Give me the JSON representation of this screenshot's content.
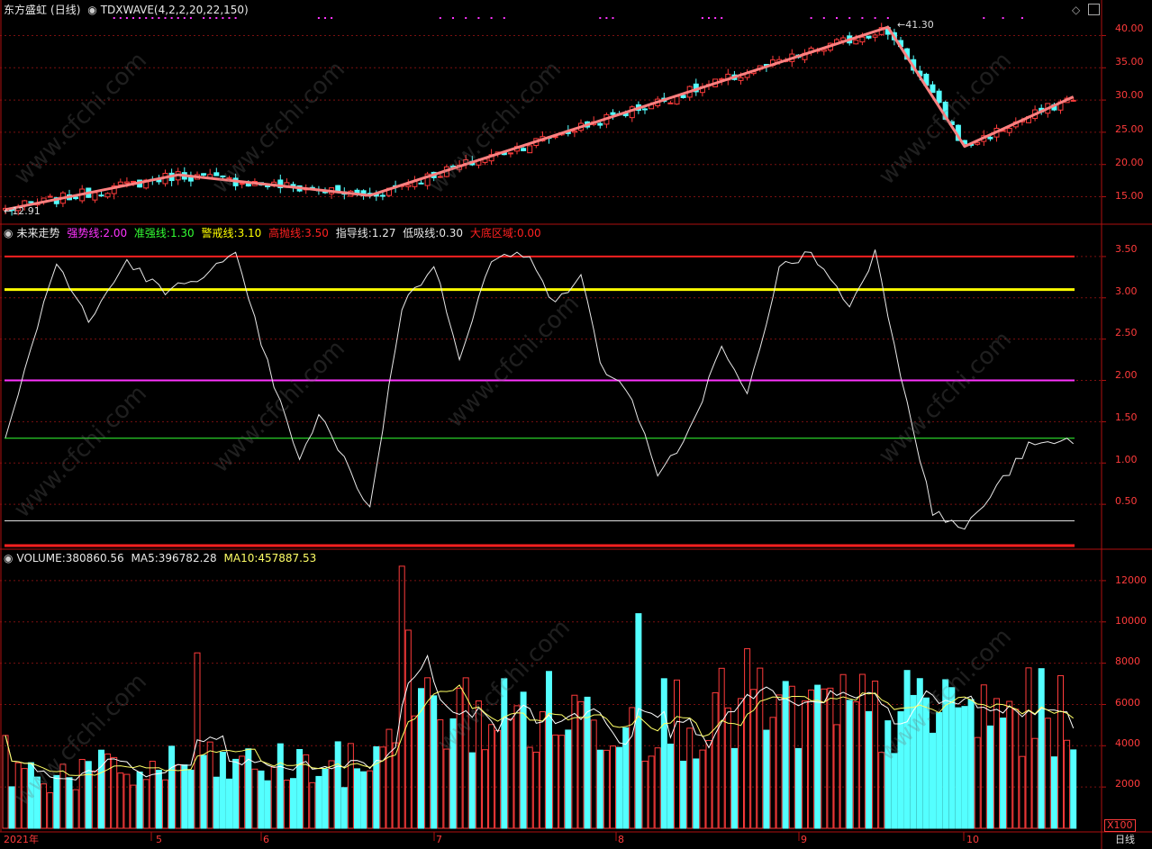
{
  "main": {
    "stock_name": "东方盛虹",
    "period": "(日线)",
    "indicator": "TDXWAVE(4,2,2,20,22,150)",
    "high_label": "41.30",
    "low_label": "12.91",
    "yaxis": [
      "40.00",
      "35.00",
      "30.00",
      "25.00",
      "20.00",
      "15.00"
    ]
  },
  "osc": {
    "title": "未来走势",
    "strong_label": "强势线:",
    "strong_val": "2.00",
    "quasi_label": "准强线:",
    "quasi_val": "1.30",
    "warn_label": "警戒线:",
    "warn_val": "3.10",
    "high_label": "高抛线:",
    "high_val": "3.50",
    "guide_label": "指导线:",
    "guide_val": "1.27",
    "low_label": "低吸线:",
    "low_val": "0.30",
    "bottom_label": "大底区域:",
    "bottom_val": "0.00",
    "yaxis": [
      "3.50",
      "3.00",
      "2.50",
      "2.00",
      "1.50",
      "1.00",
      "0.50"
    ]
  },
  "vol": {
    "volume_label": "VOLUME:",
    "volume_val": "380860.56",
    "ma5_label": "MA5:",
    "ma5_val": "396782.28",
    "ma10_label": "MA10:",
    "ma10_val": "457887.53",
    "yaxis": [
      "12000",
      "10000",
      "8000",
      "6000",
      "4000",
      "2000"
    ],
    "unit": "X100"
  },
  "xaxis": {
    "labels": [
      "2021年",
      "5",
      "6",
      "7",
      "8",
      "9",
      "10"
    ],
    "period_label": "日线"
  },
  "watermark": "www.cfchi.com",
  "colors": {
    "up": "#ff3b3b",
    "down": "#54ffff",
    "wave": "#ff8080",
    "strong": "#ff33ff",
    "quasi": "#33ff33",
    "warn": "#ffff00",
    "high": "#ff2020",
    "guide": "#ffffff",
    "ma10": "#ffff66"
  },
  "chart_data": [
    {
      "type": "candlestick",
      "title": "TDXWAVE(4,2,2,20,22,150)",
      "y_range": [
        12,
        43
      ],
      "waypoints": [
        [
          0,
          13.0
        ],
        [
          27,
          18.4
        ],
        [
          57,
          15.2
        ],
        [
          138,
          41.3
        ],
        [
          150,
          22.8
        ],
        [
          167,
          30.5
        ]
      ],
      "annotations": {
        "max": 41.3,
        "min": 12.91
      }
    },
    {
      "type": "line",
      "title": "未来走势",
      "y_range": [
        0,
        3.75
      ],
      "lines": {
        "强势线": 2.0,
        "准强线": 1.3,
        "警戒线": 3.1,
        "高抛线": 3.5,
        "低吸线": 0.3,
        "大底区域": 0.0
      },
      "guide_last": 1.27,
      "waypoints": [
        [
          0,
          1.3
        ],
        [
          8,
          3.45
        ],
        [
          13,
          2.7
        ],
        [
          19,
          3.45
        ],
        [
          25,
          3.05
        ],
        [
          36,
          3.5
        ],
        [
          41,
          2.2
        ],
        [
          46,
          1.0
        ],
        [
          49,
          1.6
        ],
        [
          57,
          0.45
        ],
        [
          62,
          2.9
        ],
        [
          67,
          3.4
        ],
        [
          71,
          2.3
        ],
        [
          76,
          3.45
        ],
        [
          82,
          3.55
        ],
        [
          86,
          2.9
        ],
        [
          90,
          3.3
        ],
        [
          93,
          2.2
        ],
        [
          98,
          1.8
        ],
        [
          102,
          0.8
        ],
        [
          107,
          1.4
        ],
        [
          112,
          2.4
        ],
        [
          116,
          1.8
        ],
        [
          121,
          3.35
        ],
        [
          126,
          3.55
        ],
        [
          132,
          2.9
        ],
        [
          136,
          3.55
        ],
        [
          140,
          2.1
        ],
        [
          145,
          0.4
        ],
        [
          150,
          0.2
        ],
        [
          160,
          1.2
        ],
        [
          167,
          1.27
        ]
      ]
    },
    {
      "type": "bar",
      "title": "VOLUME",
      "unit": "X100",
      "y_range": [
        0,
        13000
      ],
      "last": {
        "VOLUME": 380860.56,
        "MA5": 396782.28,
        "MA10": 457887.53
      },
      "key_values": [
        [
          0,
          4500
        ],
        [
          30,
          8500
        ],
        [
          62,
          12700
        ],
        [
          63,
          9600
        ],
        [
          99,
          10400
        ],
        [
          116,
          8700
        ],
        [
          147,
          7200
        ],
        [
          167,
          3800
        ]
      ]
    }
  ]
}
